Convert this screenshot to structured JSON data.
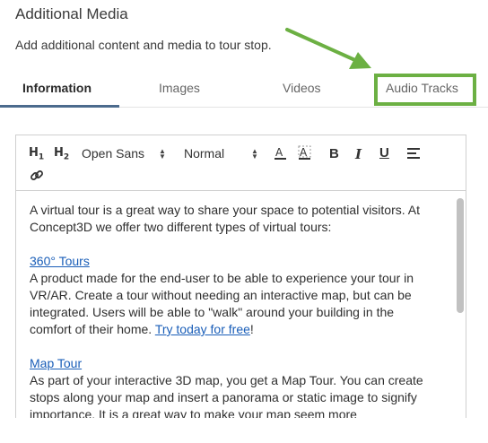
{
  "header": {
    "title": "Additional Media",
    "subtitle": "Add additional content and media to tour stop."
  },
  "tabs": [
    {
      "label": "Information",
      "active": true
    },
    {
      "label": "Images",
      "active": false
    },
    {
      "label": "Videos",
      "active": false
    },
    {
      "label": "Audio Tracks",
      "active": false
    }
  ],
  "annotation": {
    "highlight_color": "#6cb043"
  },
  "toolbar": {
    "h1": "H",
    "h1_sub": "1",
    "h2": "H",
    "h2_sub": "2",
    "font": "Open Sans",
    "size": "Normal",
    "bold": "B",
    "italic": "I",
    "underline": "U"
  },
  "content": {
    "intro": "A virtual tour is a great way to share your space to potential visitors. At Concept3D we offer two different types of virtual tours:",
    "tours360": {
      "link": "360° Tours",
      "text": "A product made for the end-user to be able to experience your tour in VR/AR. Create a tour without needing an interactive map, but can be integrated. Users will be able to \"walk\" around your building in the comfort of their home. ",
      "cta": "Try today for free",
      "after": "!"
    },
    "maptour": {
      "link": "Map Tour",
      "text": "As part of your interactive 3D map, you get a Map Tour. You can create stops along your map and insert a panorama or static image to signify importance. It is a great way to make your map seem more"
    }
  },
  "colors": {
    "link": "#1a5eb8",
    "tab_indicator": "#4c6b8d"
  }
}
